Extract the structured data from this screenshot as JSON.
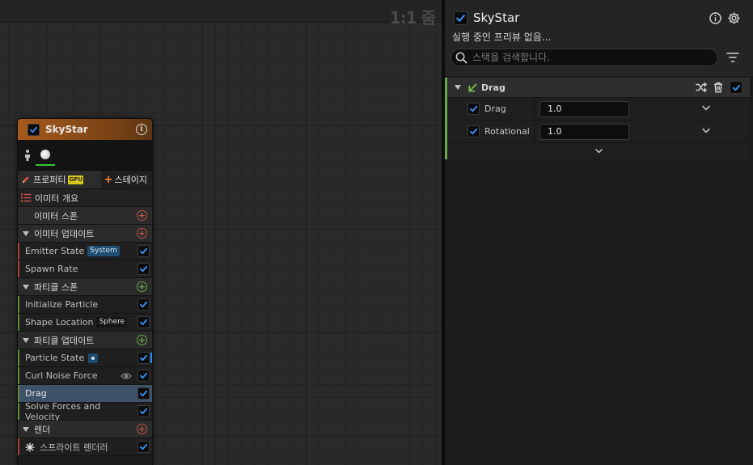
{
  "graph": {
    "zoom_label": "1:1 줌"
  },
  "node": {
    "title": "SkyStar",
    "enabled": true,
    "tabs": {
      "properties_label": "프로퍼티",
      "gpu_badge": "GPU",
      "stage_label": "스테이지"
    },
    "summary_label": "이미터 개요",
    "sections": {
      "emitter_spawn": "이미터 스폰",
      "emitter_update": "이미터 업데이트",
      "particle_spawn": "파티클 스폰",
      "particle_update": "파티클 업데이트",
      "render": "렌더"
    },
    "modules": {
      "emitter_state": {
        "label": "Emitter State",
        "badge": "System"
      },
      "spawn_rate": {
        "label": "Spawn Rate"
      },
      "initialize_particle": {
        "label": "Initialize Particle"
      },
      "shape_location": {
        "label": "Shape Location",
        "badge": "Sphere"
      },
      "particle_state": {
        "label": "Particle State"
      },
      "curl_noise_force": {
        "label": "Curl Noise Force"
      },
      "drag": {
        "label": "Drag"
      },
      "solve_forces": {
        "label": "Solve Forces and Velocity"
      },
      "sprite_renderer": {
        "label": "스프라이트 렌더러"
      }
    }
  },
  "details": {
    "title": "SkyStar",
    "subtitle": "실행 중인 프리뷰 없음...",
    "search": {
      "placeholder": "스택을 검색합니다."
    },
    "category": {
      "title": "Drag",
      "properties": [
        {
          "label": "Drag",
          "value": "1.0"
        },
        {
          "label": "Rotational",
          "value": "1.0"
        }
      ]
    }
  },
  "colors": {
    "node_header": "#a55a1c",
    "check_blue": "#2a8cff",
    "selected_row": "#3e5268",
    "emitter_red": "#c0564a",
    "particle_green": "#6fa74a",
    "gpu_yellow": "#d8c81c",
    "category_accent": "#6aa84f"
  }
}
